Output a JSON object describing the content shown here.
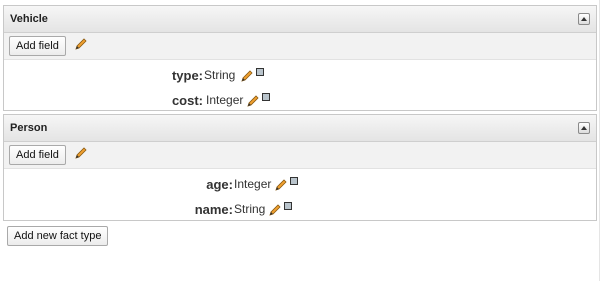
{
  "fact_types": [
    {
      "name": "Vehicle",
      "add_field_label": "Add field",
      "fields": [
        {
          "name": "type:",
          "type": "String"
        },
        {
          "name": "cost:",
          "type": "Integer"
        }
      ]
    },
    {
      "name": "Person",
      "add_field_label": "Add field",
      "fields": [
        {
          "name": "age:",
          "type": "Integer"
        },
        {
          "name": "name:",
          "type": "String"
        }
      ]
    }
  ],
  "add_fact_type_label": "Add new fact type",
  "icons": {
    "edit": "pencil-icon",
    "remove": "remove-icon",
    "collapse": "collapse-icon"
  },
  "colors": {
    "header_bg": "#e8e8e8",
    "toolbar_bg": "#f2f2f2",
    "border": "#c8c8c8",
    "pencil": "#f0a030"
  }
}
